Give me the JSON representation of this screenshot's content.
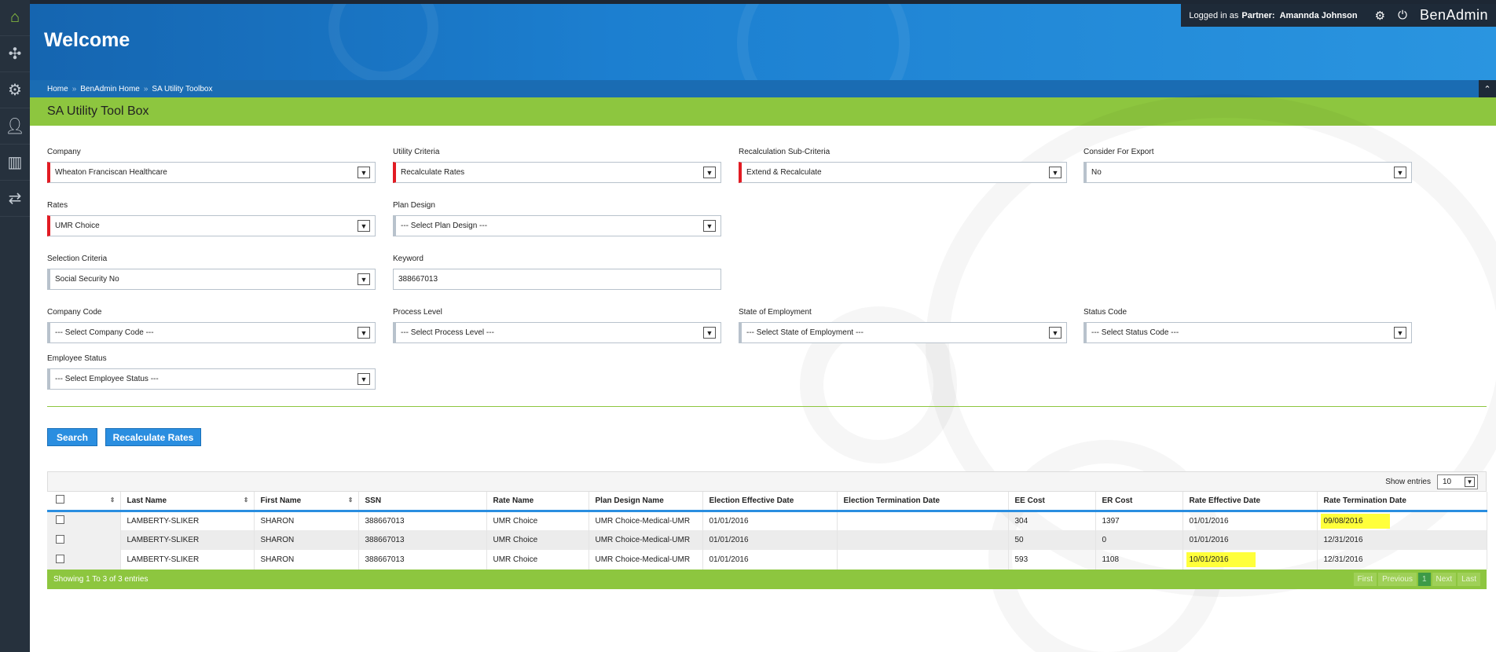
{
  "header": {
    "welcome": "Welcome",
    "logged_in_label": "Logged in as",
    "partner_label": "Partner:",
    "user_name": "Amannda Johnson",
    "brand": "BenAdmin"
  },
  "breadcrumb": [
    "Home",
    "BenAdmin Home",
    "SA Utility Toolbox"
  ],
  "page_title": "SA Utility Tool Box",
  "sidebar_icons": [
    "home-icon",
    "puzzle-icon",
    "user-settings-icon",
    "user-icon",
    "bar-chart-icon",
    "transfer-icon"
  ],
  "form": {
    "company": {
      "label": "Company",
      "value": "Wheaton Franciscan Healthcare"
    },
    "utility_criteria": {
      "label": "Utility Criteria",
      "value": "Recalculate Rates"
    },
    "recalc_sub": {
      "label": "Recalculation Sub-Criteria",
      "value": "Extend & Recalculate"
    },
    "consider_export": {
      "label": "Consider For Export",
      "value": "No"
    },
    "rates": {
      "label": "Rates",
      "value": "UMR Choice"
    },
    "plan_design": {
      "label": "Plan Design",
      "value": "--- Select Plan Design ---"
    },
    "selection_criteria": {
      "label": "Selection Criteria",
      "value": "Social Security No"
    },
    "keyword": {
      "label": "Keyword",
      "value": "388667013"
    },
    "company_code": {
      "label": "Company Code",
      "value": "--- Select Company Code ---"
    },
    "process_level": {
      "label": "Process Level",
      "value": "--- Select Process Level ---"
    },
    "state_employment": {
      "label": "State of Employment",
      "value": "--- Select State of Employment ---"
    },
    "status_code": {
      "label": "Status Code",
      "value": "--- Select Status Code ---"
    },
    "employee_status": {
      "label": "Employee Status",
      "value": "--- Select Employee Status ---"
    }
  },
  "buttons": {
    "search": "Search",
    "recalculate": "Recalculate Rates"
  },
  "table": {
    "show_entries_label": "Show entries",
    "page_length": "10",
    "columns": [
      "Last Name",
      "First Name",
      "SSN",
      "Rate Name",
      "Plan Design Name",
      "Election Effective Date",
      "Election Termination Date",
      "EE Cost",
      "ER Cost",
      "Rate Effective Date",
      "Rate Termination Date"
    ],
    "rows": [
      [
        "LAMBERTY-SLIKER",
        "SHARON",
        "388667013",
        "UMR Choice",
        "UMR Choice-Medical-UMR",
        "01/01/2016",
        "",
        "304",
        "1397",
        "01/01/2016",
        "09/08/2016"
      ],
      [
        "LAMBERTY-SLIKER",
        "SHARON",
        "388667013",
        "UMR Choice",
        "UMR Choice-Medical-UMR",
        "01/01/2016",
        "",
        "50",
        "0",
        "01/01/2016",
        "12/31/2016"
      ],
      [
        "LAMBERTY-SLIKER",
        "SHARON",
        "388667013",
        "UMR Choice",
        "UMR Choice-Medical-UMR",
        "01/01/2016",
        "",
        "593",
        "1108",
        "10/01/2016",
        "12/31/2016"
      ]
    ],
    "showing": "Showing 1 To 3 of 3 entries",
    "pager": [
      "First",
      "Previous",
      "1",
      "Next",
      "Last"
    ]
  },
  "colors": {
    "accent_green": "#8dc63f",
    "accent_blue": "#2a8ee0",
    "required_red": "#e21b23",
    "highlight": "#ffff3b"
  }
}
